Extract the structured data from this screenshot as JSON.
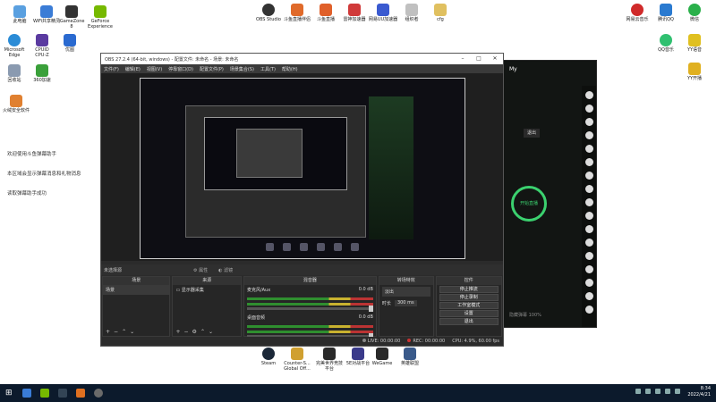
{
  "desktop_left": [
    {
      "label": "此电脑",
      "color": "#5aa0e0"
    },
    {
      "label": "WiFi共享精灵",
      "color": "#3a7cd6"
    },
    {
      "label": "iGameZone\n8",
      "color": "#333333"
    },
    {
      "label": "GeForce\nExperience",
      "color": "#76b900"
    },
    {
      "label": "Microsoft\nEdge",
      "color": "#2a8bd6"
    },
    {
      "label": "CPUID\nCPU-Z",
      "color": "#5a3aa0"
    },
    {
      "label": "优图",
      "color": "#2a6ad0"
    },
    {
      "label": "回收站",
      "color": "#8a9ab0"
    },
    {
      "label": "360加速",
      "color": "#3aa03a"
    },
    {
      "label": "火绒安全软件",
      "color": "#e08030"
    }
  ],
  "desktop_top": [
    {
      "label": "OBS Studio",
      "color": "#333333"
    },
    {
      "label": "斗鱼直播伴侣",
      "color": "#e06a2a"
    },
    {
      "label": "斗鱼直播",
      "color": "#e0602a"
    },
    {
      "label": "雷神加速器",
      "color": "#d03a3a"
    },
    {
      "label": "网易UU加速器",
      "color": "#3a5ad0"
    },
    {
      "label": "组织者",
      "color": "#c0c0c0"
    },
    {
      "label": "cfg",
      "color": "#e0c060"
    }
  ],
  "desktop_right": [
    {
      "label": "网易云音乐",
      "color": "#d02a2a"
    },
    {
      "label": "腾讯QQ",
      "color": "#2a7ad0"
    },
    {
      "label": "微信",
      "color": "#2ab04a"
    },
    {
      "label": "QQ音乐",
      "color": "#30c070"
    },
    {
      "label": "YY语音",
      "color": "#e0c020"
    },
    {
      "label": "YY开播",
      "color": "#e0b020"
    }
  ],
  "desktop_bottom": [
    {
      "label": "Steam",
      "color": "#1b2838"
    },
    {
      "label": "Counter-S...\nGlobal Off...",
      "color": "#d0a030"
    },
    {
      "label": "完美世界竞技\n平台",
      "color": "#2a2a2a"
    },
    {
      "label": "5E对战平台",
      "color": "#3a3a8a"
    },
    {
      "label": "WeGame",
      "color": "#2a2a2a"
    },
    {
      "label": "英雄联盟",
      "color": "#3a5a8a"
    }
  ],
  "side_texts": [
    "欢迎使用斗鱼弹幕助手",
    "本区域会显示弹幕消息和礼物消息",
    "读取弹幕助手成功"
  ],
  "obs": {
    "title": "OBS 27.2.4 (64-bit, windows) - 配置文件: 未命名 - 场景: 未命名",
    "menu": [
      "文件(F)",
      "编辑(E)",
      "视图(V)",
      "停靠窗口(D)",
      "配置文件(P)",
      "场景集合(S)",
      "工具(T)",
      "帮助(H)"
    ],
    "scene_bar": {
      "label": "未选择源",
      "properties": "属性",
      "filters": "滤镜"
    },
    "docks": {
      "scenes": {
        "header": "场景",
        "items": [
          "场景"
        ]
      },
      "sources": {
        "header": "来源",
        "items": [
          "显示器采集"
        ]
      },
      "mixer": {
        "header": "混音器",
        "channels": [
          {
            "name": "麦克风/Aux",
            "db": "0.0 dB",
            "level": 0.82
          },
          {
            "name": "桌面音频",
            "db": "0.0 dB",
            "level": 0.65
          }
        ]
      },
      "transitions": {
        "header": "转场特效",
        "type": "淡出",
        "duration_label": "时长",
        "duration": "300 ms"
      },
      "controls": {
        "header": "控件",
        "buttons": [
          "停止推流",
          "停止录制",
          "工作室模式",
          "设置",
          "退出"
        ]
      }
    },
    "status": {
      "live": "LIVE: 00:00:00",
      "rec": "REC: 00:00:00",
      "cpu": "CPU: 4.9%, 60.00 fps"
    }
  },
  "side_app": {
    "title": "My",
    "circle_label": "开始直播",
    "button": "退出",
    "bottom": "隐藏弹幕 100%"
  },
  "taskbar": {
    "icons": [
      "#3a7cd6",
      "#76b900",
      "#334455",
      "#e07020",
      "#6a6a6a"
    ],
    "time": "8:34",
    "date": "2022/4/21"
  }
}
